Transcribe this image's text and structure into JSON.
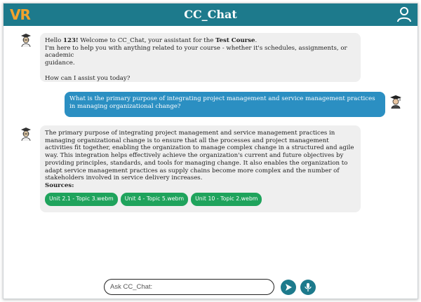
{
  "header": {
    "logo_text": "VR",
    "title": "CC_Chat",
    "user_icon": "user-icon",
    "color": "#1d7a8c"
  },
  "messages": [
    {
      "role": "bot",
      "icon": "teacher-avatar",
      "greeting_prefix": "Hello ",
      "user_name": "123!",
      "greeting_mid": " Welcome to CC_Chat, your assistant for the ",
      "course_name": "Test Course",
      "greeting_end": ".",
      "line_2": "I'm here to help you with anything related to your course - whether it's schedules, assignments, or academic",
      "line_3": "guidance.",
      "question": "How can I assist you today?"
    },
    {
      "role": "user",
      "icon": "graduate-avatar",
      "text": "What is the primary purpose of integrating project management and service management practices in managing organizational change?"
    },
    {
      "role": "bot",
      "icon": "teacher-avatar",
      "text": "The primary purpose of integrating project management and service management practices in managing organizational change is to ensure that all the processes and project management activities fit together, enabling the organization to manage complex change in a structured and agile way. This integration helps effectively achieve the organization's current and future objectives by providing principles, standards, and tools for managing change. It also enables the organization to adapt service management practices as supply chains become more complex and the number of stakeholders involved in service delivery increases.",
      "sources_label": "Sources:",
      "sources": [
        "Unit 2.1 - Topic 3.webm",
        "Unit 4 - Topic 5.webm",
        "Unit 10 - Topic 2.webm"
      ]
    }
  ],
  "input": {
    "placeholder": "Ask CC_Chat:",
    "value": ""
  },
  "buttons": {
    "send_icon": "send-icon",
    "mic_icon": "microphone-icon"
  },
  "colors": {
    "user_bubble": "#2b8fc2",
    "bot_bubble": "#efefef",
    "source_chip": "#1fa35c",
    "logo": "#f2a22c"
  }
}
